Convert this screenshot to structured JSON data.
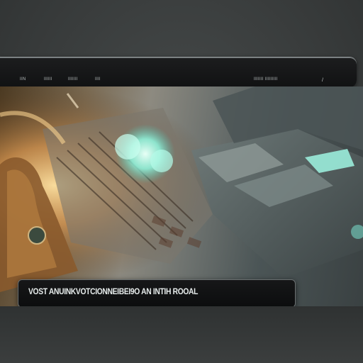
{
  "header": {
    "nav": [
      "IIN",
      "IIIIII",
      "IIIIIII",
      "IIII"
    ],
    "right_label": "IIIIIII IIIIIIIII",
    "menu_icon": "slash-menu-icon"
  },
  "scene": {
    "description_icon": "battle-scene-illustration"
  },
  "caption": {
    "text": "VOST ANUINKVOTCIONNEIBEI9O AN INTIH ROOAL"
  },
  "colors": {
    "background": "#3a3d3d",
    "bar": "#111213",
    "accent_cyan": "#7ff5e0",
    "accent_fire": "#f0b060"
  }
}
